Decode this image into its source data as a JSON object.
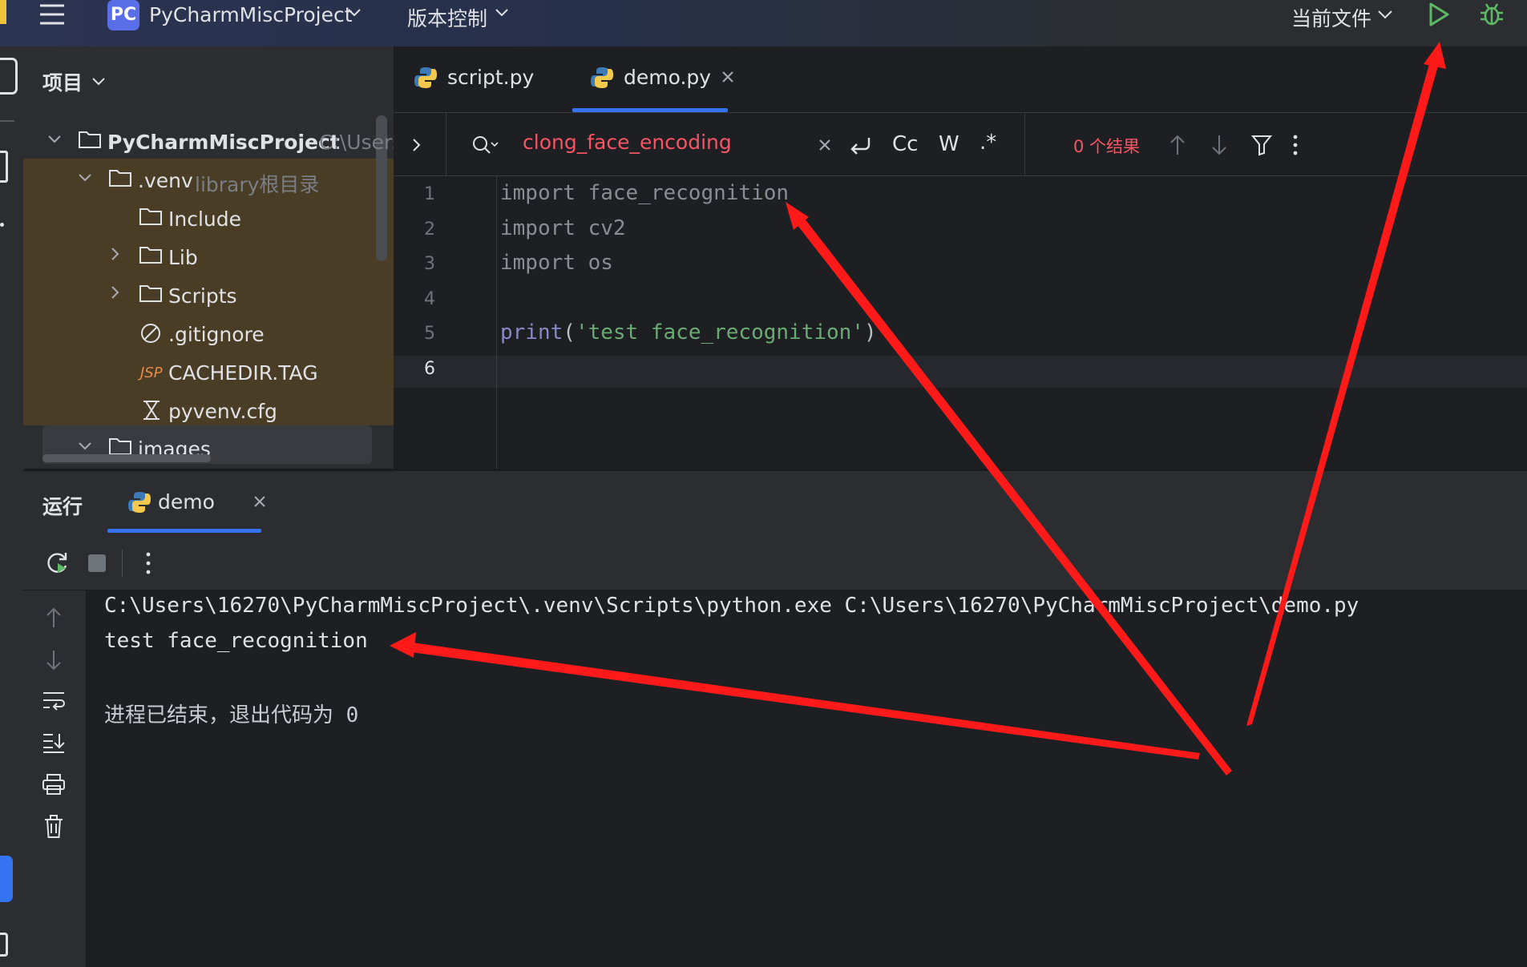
{
  "topbar": {
    "project_badge": "PC",
    "project_name": "PyCharmMiscProject",
    "vcs_label": "版本控制",
    "run_config": "当前文件"
  },
  "project_panel": {
    "title": "项目",
    "tree": [
      {
        "label": "PyCharmMiscProject",
        "hint": "C:\\Users"
      },
      {
        "label": ".venv",
        "hint": "library根目录"
      },
      {
        "label": "Include"
      },
      {
        "label": "Lib"
      },
      {
        "label": "Scripts"
      },
      {
        "label": ".gitignore"
      },
      {
        "label": "CACHEDIR.TAG",
        "icon_text": "JSP"
      },
      {
        "label": "pyvenv.cfg"
      },
      {
        "label": "images"
      }
    ]
  },
  "editor": {
    "tabs": [
      {
        "label": "script.py"
      },
      {
        "label": "demo.py"
      }
    ],
    "find": {
      "query": "clong_face_encoding",
      "case_label": "Cc",
      "word_label": "W",
      "regex_label": ".*",
      "result": "0 个结果"
    },
    "lines": [
      {
        "num": "1",
        "kw": "import",
        "rest": " face_recognition"
      },
      {
        "num": "2",
        "kw": "import",
        "rest": " cv2"
      },
      {
        "num": "3",
        "kw": "import",
        "rest": " os"
      },
      {
        "num": "4",
        "kw": "",
        "rest": ""
      },
      {
        "num": "5",
        "fn": "print",
        "p1": "(",
        "str": "'test face_recognition'",
        "p2": ")"
      },
      {
        "num": "6",
        "kw": "",
        "rest": ""
      }
    ]
  },
  "run_panel": {
    "title": "运行",
    "tab": "demo",
    "output": [
      "C:\\Users\\16270\\PyCharmMiscProject\\.venv\\Scripts\\python.exe C:\\Users\\16270\\PyCharmMiscProject\\demo.py",
      "test face_recognition",
      "",
      "进程已结束，退出代码为 0"
    ]
  },
  "colors": {
    "accent": "#3574f0",
    "annotation_arrow": "#ff1a1a",
    "search_error": "#f75464",
    "run_green": "#5fb865",
    "keyword": "#cf8e6d",
    "string": "#6aab73",
    "builtin": "#8888c6"
  }
}
